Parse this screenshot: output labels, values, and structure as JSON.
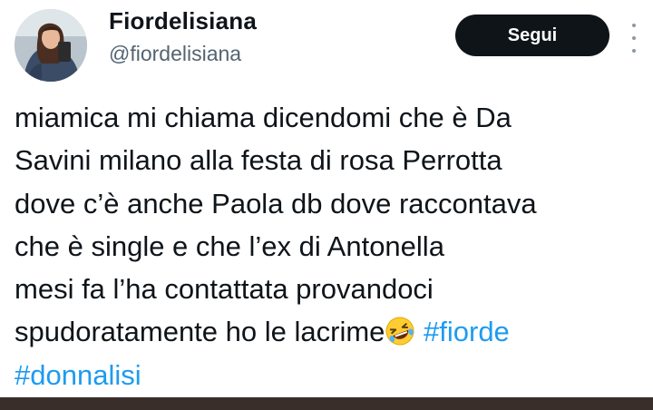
{
  "user": {
    "display_name": "Fiordelisiana",
    "handle": "@fiordelisiana"
  },
  "follow_button": {
    "label": "Segui"
  },
  "icons": {
    "avatar": "profile-photo",
    "more": "more-options-icon",
    "emoji": "rolling-on-the-floor-laughing-emoji"
  },
  "tweet": {
    "lines": [
      "miamica mi chiama dicendomi che è Da",
      "Savini milano alla festa di rosa Perrotta",
      "dove c’è anche Paola db dove raccontava",
      "che è single e che l’ex di Antonella",
      "mesi fa l’ha contattata provandoci",
      "spudoratamente ho le lacrime"
    ],
    "hashtags": [
      "#fiorde",
      "#donnalisi"
    ]
  },
  "colors": {
    "text": "#0f1419",
    "secondary_text": "#536471",
    "hashtag": "#1d9bf0",
    "button_bg": "#0f1419",
    "button_text": "#ffffff",
    "bottom_bar": "#3a2e2b"
  }
}
